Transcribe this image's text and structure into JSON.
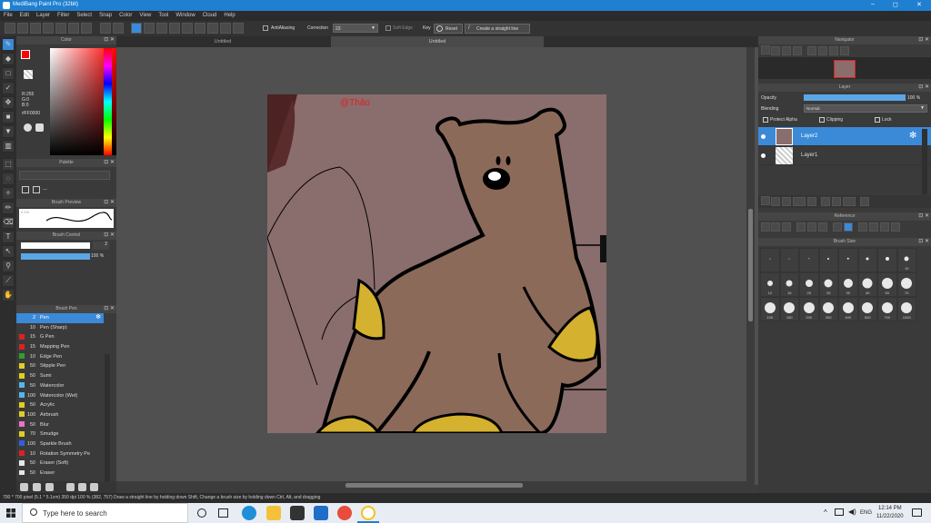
{
  "app": {
    "title": "MediBang Paint Pro (32bit)"
  },
  "window_controls": {
    "minimize": "–",
    "maximize": "◻",
    "close": "✕"
  },
  "menu": [
    "File",
    "Edit",
    "Layer",
    "Filter",
    "Select",
    "Snap",
    "Color",
    "View",
    "Tool",
    "Window",
    "Cloud",
    "Help"
  ],
  "toolbar": {
    "antialiasing": "AntiAliasing",
    "correction_label": "Correction",
    "correction_value": "23",
    "soft_edge": "Soft Edge",
    "key": "Key",
    "reset": "Reset",
    "straight_line": "Create a straight line"
  },
  "tabs": [
    "Untitled",
    "Untitled"
  ],
  "color_panel": {
    "title": "Color",
    "r": "R:255",
    "g": "G:0",
    "b": "B:0",
    "hex": "#FF0000",
    "primary": "#ff0000",
    "secondary": "#ffffff"
  },
  "palette": {
    "title": "Palette",
    "menu": "---"
  },
  "brush_preview": {
    "title": "Brush Preview",
    "value": "0.1%"
  },
  "brush_control": {
    "title": "Brush Control",
    "size": "2",
    "opacity": "100 %"
  },
  "brush_list": {
    "title": "Brush Pen",
    "items": [
      {
        "size": "2",
        "name": "Pen",
        "color": "#3b8ad8"
      },
      {
        "size": "10",
        "name": "Pen (Sharp)",
        "color": "#3c3c3c"
      },
      {
        "size": "15",
        "name": "G Pen",
        "color": "#e02020"
      },
      {
        "size": "15",
        "name": "Mapping Pen",
        "color": "#e02020"
      },
      {
        "size": "10",
        "name": "Edge Pen",
        "color": "#2fa02f"
      },
      {
        "size": "50",
        "name": "Stipple Pen",
        "color": "#e0d020"
      },
      {
        "size": "50",
        "name": "Sumi",
        "color": "#e0d020"
      },
      {
        "size": "50",
        "name": "Watercolor",
        "color": "#50b8f0"
      },
      {
        "size": "100",
        "name": "Watercolor (Wet)",
        "color": "#50b8f0"
      },
      {
        "size": "50",
        "name": "Acrylic",
        "color": "#e0d020"
      },
      {
        "size": "100",
        "name": "Airbrush",
        "color": "#e0d020"
      },
      {
        "size": "50",
        "name": "Blur",
        "color": "#f070c8"
      },
      {
        "size": "70",
        "name": "Smudge",
        "color": "#e0d020"
      },
      {
        "size": "100",
        "name": "Sparkle Brush",
        "color": "#3060e0"
      },
      {
        "size": "10",
        "name": "Rotation Symmetry Pe",
        "color": "#e02020"
      },
      {
        "size": "50",
        "name": "Eraser (Soft)",
        "color": "#e8e8e8"
      },
      {
        "size": "50",
        "name": "Eraser",
        "color": "#e8e8e8"
      }
    ]
  },
  "canvas": {
    "watermark": "@Thảo"
  },
  "navigator": {
    "title": "Navigator"
  },
  "layer_panel": {
    "title": "Layer",
    "opacity_label": "Opacity",
    "opacity_value": "100 %",
    "blending_label": "Blending",
    "blending_value": "Normal",
    "protect_alpha": "Protect Alpha",
    "clipping": "Clipping",
    "lock": "Lock",
    "layers": [
      {
        "name": "Layer2",
        "selected": true
      },
      {
        "name": "Layer1",
        "selected": false
      }
    ]
  },
  "reference": {
    "title": "Reference"
  },
  "brush_size": {
    "title": "Brush Size",
    "sizes": [
      "",
      "",
      "",
      "",
      "",
      "",
      "",
      "10",
      "12",
      "15",
      "20",
      "25",
      "30",
      "40",
      "50",
      "70",
      "100",
      "150",
      "200",
      "250",
      "400",
      "500",
      "700",
      "1000"
    ]
  },
  "status": {
    "text": "700 * 700 pixel  (5.1 * 5.1cm)  350 dpi  100 %  (382, 757)  Draw a straight line by holding down Shift, Change a brush size by holding down Ctrl, Alt, and dragging"
  },
  "taskbar": {
    "search_placeholder": "Type here to search",
    "time": "12:14 PM",
    "date": "11/22/2020",
    "lang": "ENG"
  }
}
